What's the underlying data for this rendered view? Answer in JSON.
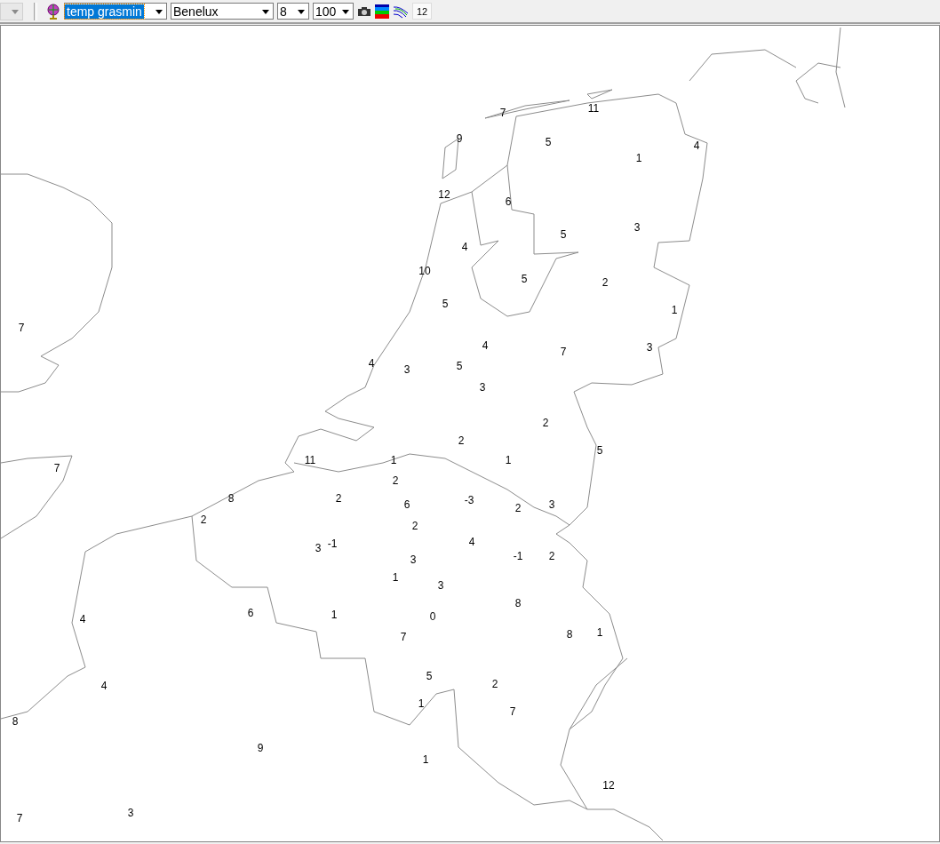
{
  "toolbar": {
    "disabled_dropdown": {
      "disabled": true
    },
    "parameter": {
      "value": "temp grasmin",
      "selected": true
    },
    "region": {
      "value": "Benelux"
    },
    "level": {
      "value": "8"
    },
    "zoom": {
      "value": "100"
    },
    "count_button": {
      "label": "12"
    }
  },
  "map": {
    "stations": [
      {
        "value": "7"
      },
      {
        "value": "11"
      },
      {
        "value": "9"
      },
      {
        "value": "5"
      },
      {
        "value": "1"
      },
      {
        "value": "4"
      },
      {
        "value": "12"
      },
      {
        "value": "6"
      },
      {
        "value": "3"
      },
      {
        "value": "5"
      },
      {
        "value": "4"
      },
      {
        "value": "10"
      },
      {
        "value": "5"
      },
      {
        "value": "2"
      },
      {
        "value": "5"
      },
      {
        "value": "1"
      },
      {
        "value": "7"
      },
      {
        "value": "4"
      },
      {
        "value": "7"
      },
      {
        "value": "3"
      },
      {
        "value": "4"
      },
      {
        "value": "3"
      },
      {
        "value": "5"
      },
      {
        "value": "3"
      },
      {
        "value": "2"
      },
      {
        "value": "2"
      },
      {
        "value": "5"
      },
      {
        "value": "11"
      },
      {
        "value": "1"
      },
      {
        "value": "1"
      },
      {
        "value": "7"
      },
      {
        "value": "2"
      },
      {
        "value": "8"
      },
      {
        "value": "2"
      },
      {
        "value": "6"
      },
      {
        "value": "-3"
      },
      {
        "value": "2"
      },
      {
        "value": "3"
      },
      {
        "value": "2"
      },
      {
        "value": "2"
      },
      {
        "value": "3"
      },
      {
        "value": "-1"
      },
      {
        "value": "4"
      },
      {
        "value": "-1"
      },
      {
        "value": "2"
      },
      {
        "value": "3"
      },
      {
        "value": "1"
      },
      {
        "value": "3"
      },
      {
        "value": "8"
      },
      {
        "value": "6"
      },
      {
        "value": "1"
      },
      {
        "value": "0"
      },
      {
        "value": "7"
      },
      {
        "value": "8"
      },
      {
        "value": "1"
      },
      {
        "value": "4"
      },
      {
        "value": "4"
      },
      {
        "value": "5"
      },
      {
        "value": "2"
      },
      {
        "value": "1"
      },
      {
        "value": "7"
      },
      {
        "value": "8"
      },
      {
        "value": "9"
      },
      {
        "value": "1"
      },
      {
        "value": "12"
      },
      {
        "value": "7"
      },
      {
        "value": "3"
      }
    ]
  }
}
